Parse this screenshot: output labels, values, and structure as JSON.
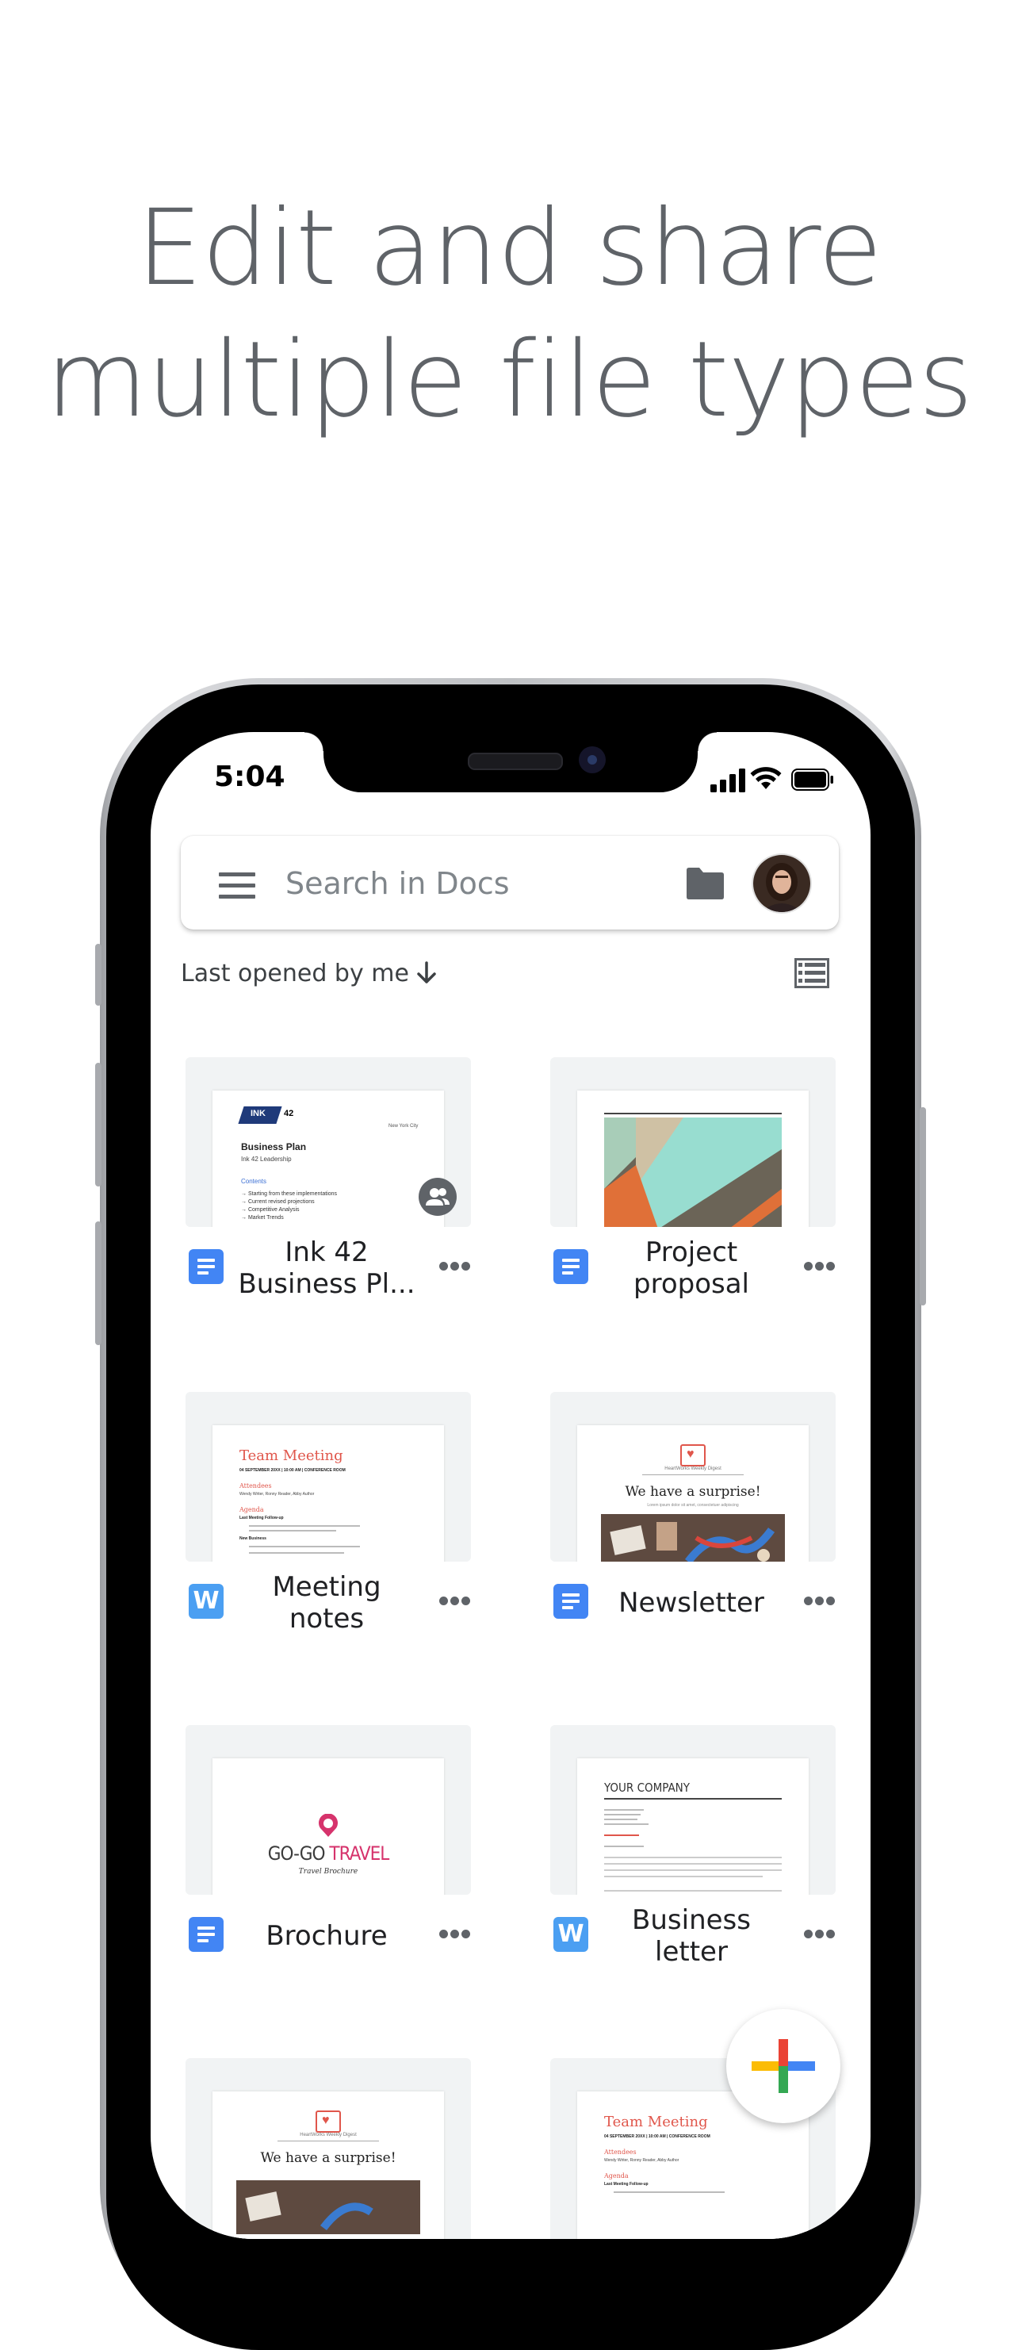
{
  "headline": {
    "line1": "Edit and share",
    "line2": "multiple file types"
  },
  "status_bar": {
    "time": "5:04"
  },
  "search": {
    "placeholder": "Search in Docs"
  },
  "sort": {
    "label": "Last opened by me"
  },
  "files": [
    {
      "title_line1": "Ink 42",
      "title_line2": "Business Pl...",
      "type": "docs",
      "shared": true
    },
    {
      "title_line1": "Project",
      "title_line2": "proposal",
      "type": "docs"
    },
    {
      "title_line1": "Meeting",
      "title_line2": "notes",
      "type": "word"
    },
    {
      "title_line1": "Newsletter",
      "title_line2": "",
      "type": "docs"
    },
    {
      "title_line1": "Brochure",
      "title_line2": "",
      "type": "docs"
    },
    {
      "title_line1": "Business",
      "title_line2": "letter",
      "type": "word"
    }
  ],
  "thumbs": {
    "ink42": {
      "badge": "INK",
      "num": "42",
      "city": "New York City",
      "heading": "Business Plan",
      "sub": "Ink 42 Leadership",
      "contents": "Contents",
      "items": [
        "Starting from these implementations",
        "Current revised projections",
        "Competitive Analysis",
        "Market Trends"
      ]
    },
    "meeting": {
      "title": "Team Meeting",
      "date": "04 SEPTEMBER 20XX | 10:00 AM | CONFERENCE ROOM",
      "attendees": "Attendees",
      "names": "Wendy Writer, Ronny Reader, Abby Author",
      "agenda": "Agenda",
      "item1": "Last Meeting Follow-up",
      "item2": "New Business"
    },
    "newsletter": {
      "brand": "HeartWorks Weekly Digest",
      "heading": "We have a surprise!",
      "sub": "Lorem ipsum dolor sit amet, consectetuer adipiscing"
    },
    "brochure": {
      "brand_a": "GO-GO",
      "brand_b": "TRAVEL",
      "sub": "Travel Brochure"
    },
    "letter": {
      "company": "YOUR COMPANY"
    },
    "newsletter2": {
      "brand": "HeartWorks Weekly Digest",
      "heading": "We have a surprise!"
    },
    "meeting2": {
      "title": "Team Meeting",
      "date": "04 SEPTEMBER 20XX | 10:00 AM | CONFERENCE ROOM",
      "attendees": "Attendees",
      "names": "Wendy Writer, Ronny Reader, Abby Author",
      "agenda": "Agenda",
      "item1": "Last Meeting Follow-up"
    }
  },
  "icons": {
    "menu": "hamburger-menu-icon",
    "folder": "folder-icon",
    "sort": "arrow-down-icon",
    "view": "list-view-icon",
    "fab": "plus-icon"
  },
  "colors": {
    "headline": "#5f6368",
    "docs_blue": "#4285f4",
    "word_blue": "#4b9ff2",
    "red_title": "#e0564b"
  }
}
